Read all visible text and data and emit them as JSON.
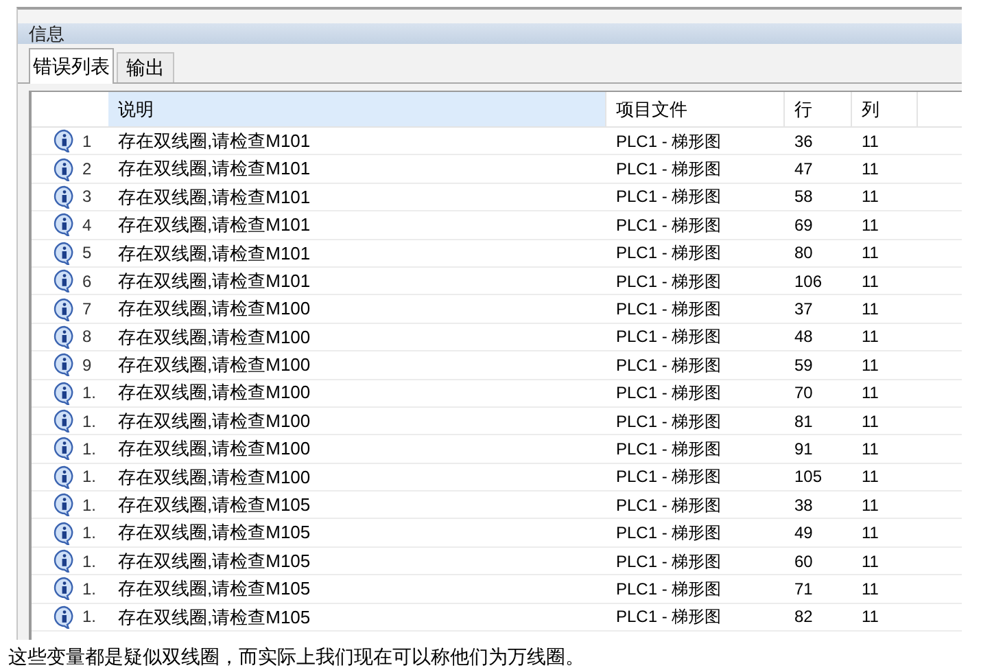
{
  "panel": {
    "title": "信息"
  },
  "tabs": [
    {
      "label": "错误列表",
      "selected": true
    },
    {
      "label": "输出",
      "selected": false
    }
  ],
  "table": {
    "columns": [
      {
        "label": "说明",
        "sorted": true
      },
      {
        "label": "项目文件",
        "sorted": false
      },
      {
        "label": "行",
        "sorted": false
      },
      {
        "label": "列",
        "sorted": false
      }
    ],
    "rows": [
      {
        "index": "1",
        "message": "存在双线圈,请检查M101",
        "file": "PLC1 - 梯形图",
        "line": "36",
        "column": "11"
      },
      {
        "index": "2",
        "message": "存在双线圈,请检查M101",
        "file": "PLC1 - 梯形图",
        "line": "47",
        "column": "11"
      },
      {
        "index": "3",
        "message": "存在双线圈,请检查M101",
        "file": "PLC1 - 梯形图",
        "line": "58",
        "column": "11"
      },
      {
        "index": "4",
        "message": "存在双线圈,请检查M101",
        "file": "PLC1 - 梯形图",
        "line": "69",
        "column": "11"
      },
      {
        "index": "5",
        "message": "存在双线圈,请检查M101",
        "file": "PLC1 - 梯形图",
        "line": "80",
        "column": "11"
      },
      {
        "index": "6",
        "message": "存在双线圈,请检查M101",
        "file": "PLC1 - 梯形图",
        "line": "106",
        "column": "11"
      },
      {
        "index": "7",
        "message": "存在双线圈,请检查M100",
        "file": "PLC1 - 梯形图",
        "line": "37",
        "column": "11"
      },
      {
        "index": "8",
        "message": "存在双线圈,请检查M100",
        "file": "PLC1 - 梯形图",
        "line": "48",
        "column": "11"
      },
      {
        "index": "9",
        "message": "存在双线圈,请检查M100",
        "file": "PLC1 - 梯形图",
        "line": "59",
        "column": "11"
      },
      {
        "index": "1.",
        "message": "存在双线圈,请检查M100",
        "file": "PLC1 - 梯形图",
        "line": "70",
        "column": "11"
      },
      {
        "index": "1.",
        "message": "存在双线圈,请检查M100",
        "file": "PLC1 - 梯形图",
        "line": "81",
        "column": "11"
      },
      {
        "index": "1.",
        "message": "存在双线圈,请检查M100",
        "file": "PLC1 - 梯形图",
        "line": "91",
        "column": "11"
      },
      {
        "index": "1.",
        "message": "存在双线圈,请检查M100",
        "file": "PLC1 - 梯形图",
        "line": "105",
        "column": "11"
      },
      {
        "index": "1.",
        "message": "存在双线圈,请检查M105",
        "file": "PLC1 - 梯形图",
        "line": "38",
        "column": "11"
      },
      {
        "index": "1.",
        "message": "存在双线圈,请检查M105",
        "file": "PLC1 - 梯形图",
        "line": "49",
        "column": "11"
      },
      {
        "index": "1.",
        "message": "存在双线圈,请检查M105",
        "file": "PLC1 - 梯形图",
        "line": "60",
        "column": "11"
      },
      {
        "index": "1.",
        "message": "存在双线圈,请检查M105",
        "file": "PLC1 - 梯形图",
        "line": "71",
        "column": "11"
      },
      {
        "index": "1.",
        "message": "存在双线圈,请检查M105",
        "file": "PLC1 - 梯形图",
        "line": "82",
        "column": "11"
      }
    ]
  },
  "caption": "这些变量都是疑似双线圈，而实际上我们现在可以称他们为万线圈。"
}
